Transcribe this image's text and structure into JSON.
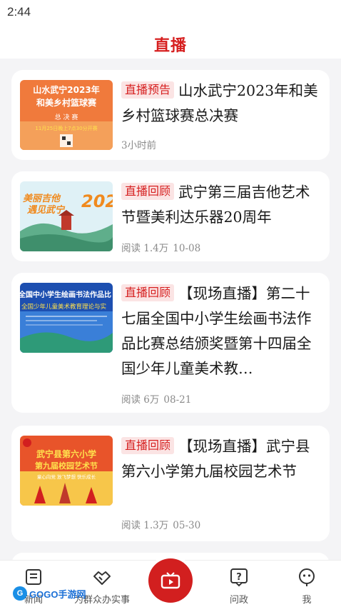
{
  "status": {
    "time": "2:44"
  },
  "header": {
    "title": "直播"
  },
  "cards": [
    {
      "tag": "直播预告",
      "title": "山水武宁2023年和美乡村篮球赛总决赛",
      "meta": "3小时前",
      "thumb": {
        "line1": "山水武宁2023年",
        "line2": "和美乡村篮球赛",
        "line3": "总 决 赛",
        "line4": "11月25日晚上7点30分开赛",
        "colors": {
          "bg": "#f07a3c",
          "bg2": "#f4a05a",
          "text": "#ffffff",
          "accent": "#ffe14d"
        }
      }
    },
    {
      "tag": "直播回顾",
      "title": "武宁第三届吉他艺术节暨美利达乐器20周年",
      "meta_reads": "阅读 1.4万",
      "meta_date": "10-08",
      "thumb": {
        "line1": "美丽吉他",
        "line2": "遇见武宁",
        "line3": "202",
        "colors": {
          "sky": "#dff1f6",
          "hill": "#5fae8b",
          "text": "#f08a1e"
        }
      }
    },
    {
      "tag": "直播回顾",
      "title": "【现场直播】第二十七届全国中小学生绘画书法作品比赛总结颁奖暨第十四届全国少年儿童美术教…",
      "meta_reads": "阅读 6万",
      "meta_date": "08-21",
      "thumb": {
        "line1": "全国中小学生绘画书法作品比",
        "line2": "全国少年儿童美术教育理论与实",
        "colors": {
          "bg": "#1d4fb0",
          "bg2": "#3a7fd8",
          "text": "#ffffff",
          "accent": "#ffe14d"
        }
      }
    },
    {
      "tag": "直播回顾",
      "title": "【现场直播】武宁县第六小学第九届校园艺术节",
      "meta_reads": "阅读 1.3万",
      "meta_date": "05-30",
      "thumb": {
        "line1": "武宁县第六小学",
        "line2": "第九届校园艺术节",
        "line3": "童心向党 放飞梦想 快乐成长",
        "colors": {
          "bg": "#e8542a",
          "bg2": "#f7c64a",
          "text": "#ffe14d",
          "red": "#d21f1f"
        }
      }
    }
  ],
  "tabbar": {
    "tabs": [
      {
        "label": "新闻",
        "icon": "news-icon"
      },
      {
        "label": "为群众办实事",
        "icon": "handshake-icon"
      },
      {
        "label": "",
        "icon": "tv-icon"
      },
      {
        "label": "问政",
        "icon": "question-icon"
      },
      {
        "label": "我",
        "icon": "user-face-icon"
      }
    ]
  },
  "watermark": {
    "logo": "G",
    "text": "GOGO手游网"
  },
  "colors": {
    "accent": "#d61f1f",
    "tag_bg": "#fbe4e4",
    "meta": "#8a8a8a",
    "background": "#f4f4f6"
  }
}
